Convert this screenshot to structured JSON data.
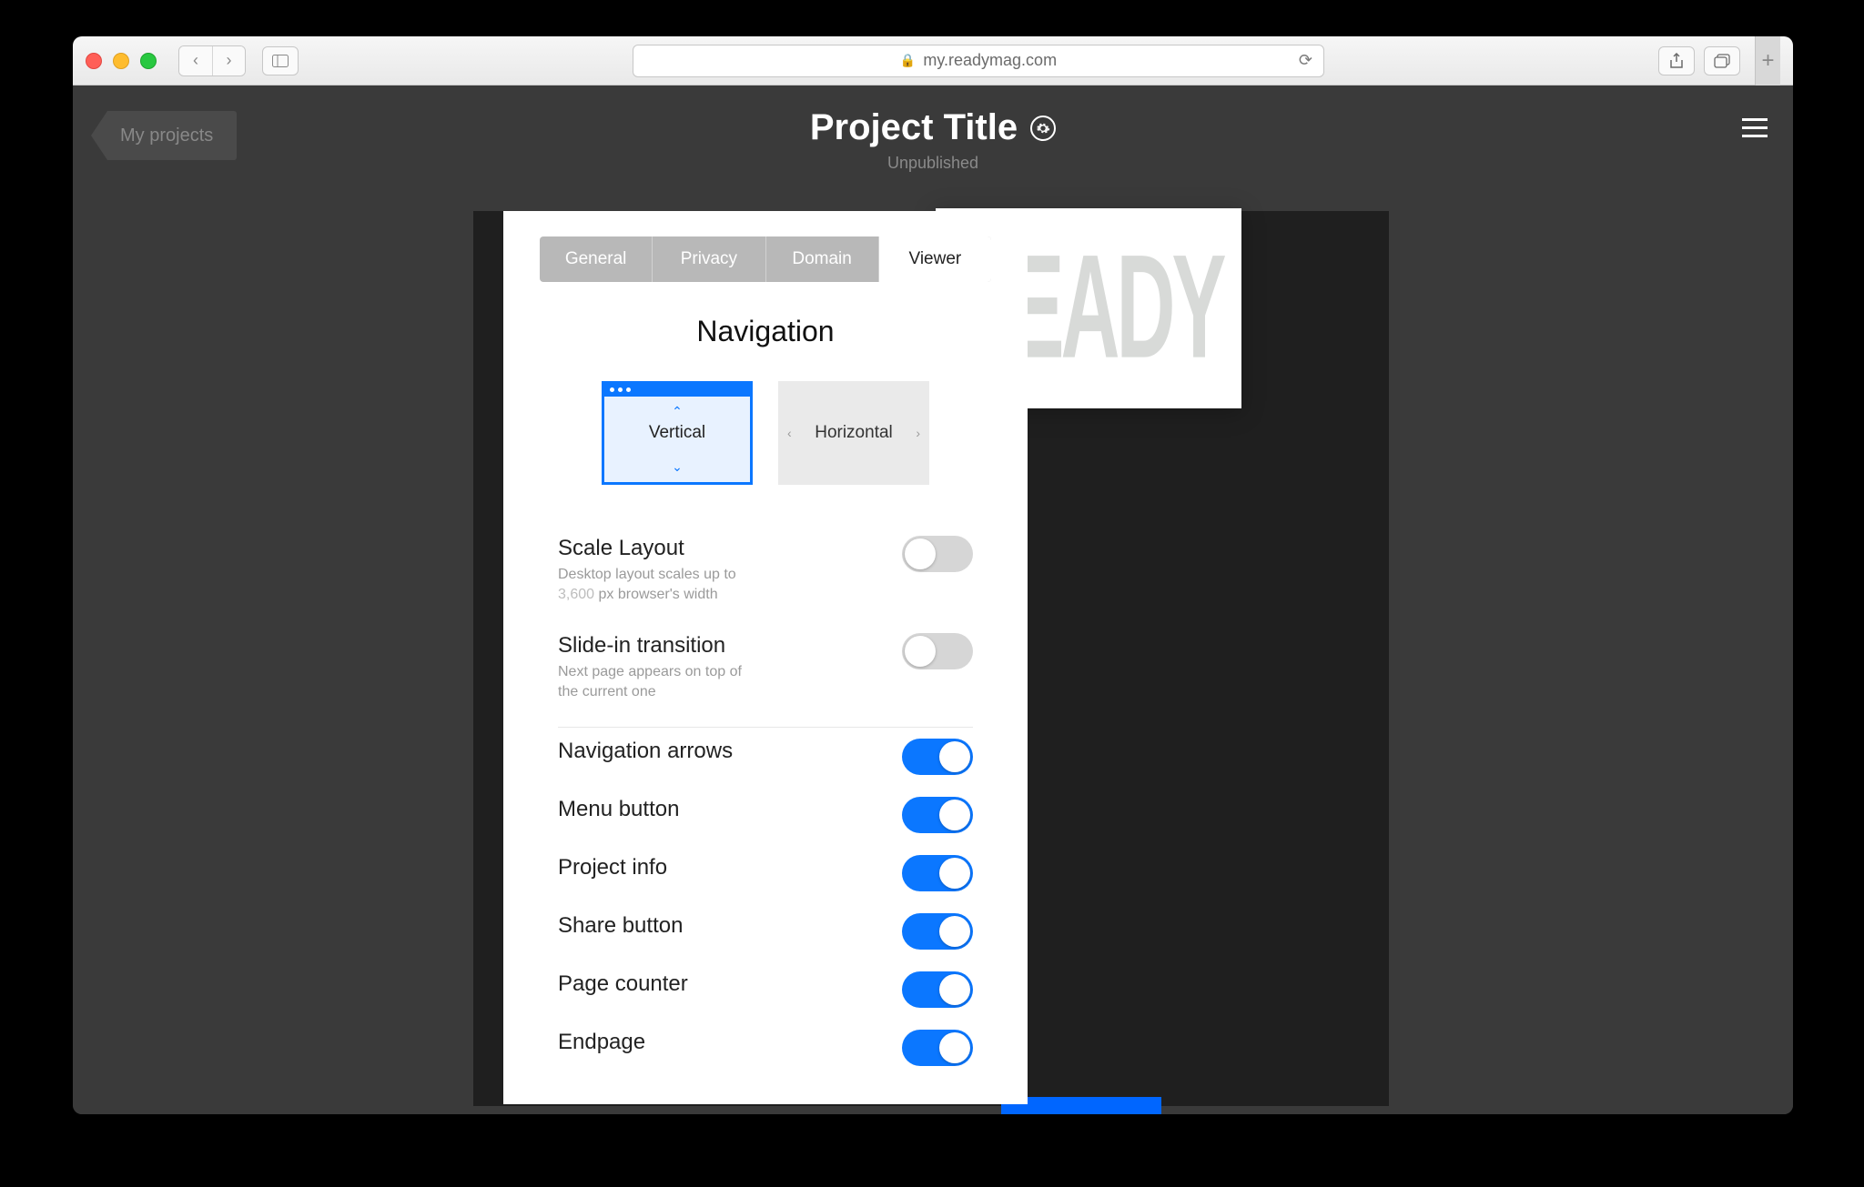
{
  "browser": {
    "url_host": "my.readymag.com",
    "back_label": "‹",
    "forward_label": "›"
  },
  "header": {
    "back_tab": "My projects",
    "title": "Project Title",
    "status": "Unpublished"
  },
  "thumbnail": {
    "text": "READY"
  },
  "settings": {
    "tabs": [
      "General",
      "Privacy",
      "Domain",
      "Viewer"
    ],
    "active_tab_index": 3,
    "section_title": "Navigation",
    "nav_modes": {
      "vertical": "Vertical",
      "horizontal": "Horizontal",
      "selected": "vertical"
    },
    "scale_layout": {
      "label": "Scale Layout",
      "desc_prefix": "Desktop layout scales up to ",
      "desc_num": "3,600",
      "desc_suffix": " px browser's width",
      "on": false
    },
    "slide_in": {
      "label": "Slide-in transition",
      "desc": "Next page appears on top of the current one",
      "on": false
    },
    "simple": [
      {
        "label": "Navigation arrows",
        "on": true
      },
      {
        "label": "Menu button",
        "on": true
      },
      {
        "label": "Project info",
        "on": true
      },
      {
        "label": "Share button",
        "on": true
      },
      {
        "label": "Page counter",
        "on": true
      },
      {
        "label": "Endpage",
        "on": true
      }
    ]
  }
}
